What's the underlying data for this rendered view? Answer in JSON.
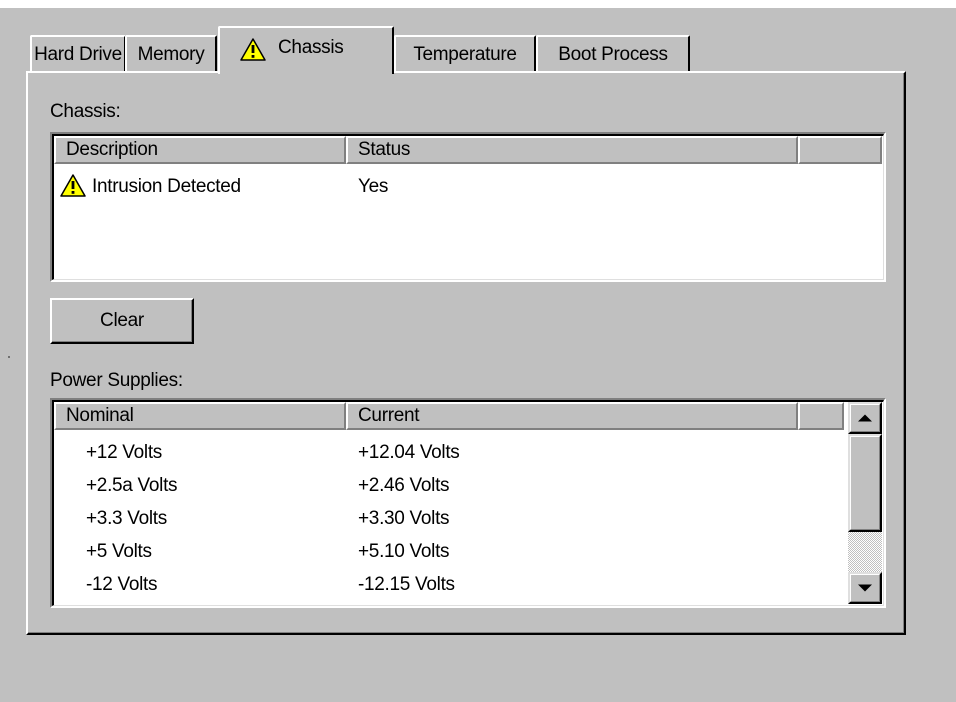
{
  "tabs": [
    {
      "label": "Hard Drive",
      "active": false
    },
    {
      "label": "Memory",
      "active": false
    },
    {
      "label": "Chassis",
      "active": true,
      "icon": "warning-icon"
    },
    {
      "label": "Temperature",
      "active": false
    },
    {
      "label": "Boot Process",
      "active": false
    }
  ],
  "chassis": {
    "section_label": "Chassis:",
    "columns": [
      "Description",
      "Status"
    ],
    "rows": [
      {
        "icon": "warning-icon",
        "description": "Intrusion Detected",
        "status": "Yes"
      }
    ],
    "clear_button": "Clear"
  },
  "power_supplies": {
    "section_label": "Power Supplies:",
    "columns": [
      "Nominal",
      "Current"
    ],
    "rows": [
      {
        "nominal": "+12 Volts",
        "current": "+12.04 Volts"
      },
      {
        "nominal": "+2.5a Volts",
        "current": "+2.46 Volts"
      },
      {
        "nominal": "+3.3 Volts",
        "current": "+3.30 Volts"
      },
      {
        "nominal": "+5 Volts",
        "current": "+5.10 Volts"
      },
      {
        "nominal": "-12 Volts",
        "current": "-12.15 Volts"
      }
    ]
  },
  "colors": {
    "dialog_face": "#c0c0c0",
    "warning_yellow": "#ffff00"
  }
}
